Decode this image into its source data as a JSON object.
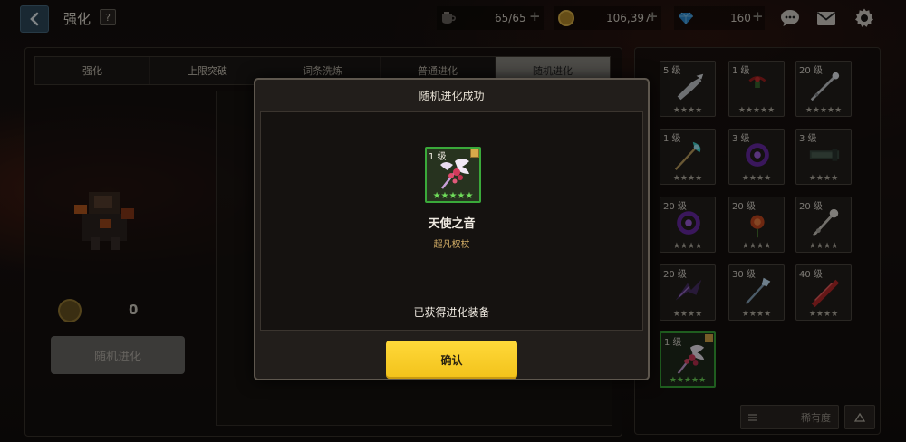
{
  "header": {
    "title": "强化",
    "help_label": "?",
    "stamina": "65/65",
    "gold": "106,397",
    "gems": "160",
    "plus": "+"
  },
  "tabs": [
    {
      "label": "强化",
      "active": false
    },
    {
      "label": "上限突破",
      "active": false
    },
    {
      "label": "词条洗炼",
      "active": false
    },
    {
      "label": "普通进化",
      "active": false
    },
    {
      "label": "随机进化",
      "active": true
    }
  ],
  "left": {
    "cost_amount": "0",
    "evolve_button": "随机进化"
  },
  "inventory": [
    {
      "level": "5 级",
      "stars": "★★★★",
      "icon": "gauntlet-icon"
    },
    {
      "level": "1 级",
      "stars": "★★★★★",
      "icon": "red-bow-icon"
    },
    {
      "level": "20 级",
      "stars": "★★★★★",
      "icon": "spiked-staff-icon"
    },
    {
      "level": "1 级",
      "stars": "★★★★",
      "icon": "cyan-staff-icon"
    },
    {
      "level": "3 级",
      "stars": "★★★★",
      "icon": "purple-ring-icon"
    },
    {
      "level": "3 级",
      "stars": "★★★★",
      "icon": "dark-cannon-icon"
    },
    {
      "level": "20 级",
      "stars": "★★★★",
      "icon": "purple-ring-icon"
    },
    {
      "level": "20 级",
      "stars": "★★★★",
      "icon": "flame-rose-icon"
    },
    {
      "level": "20 级",
      "stars": "★★★★",
      "icon": "bone-staff-icon"
    },
    {
      "level": "20 级",
      "stars": "★★★★",
      "icon": "purple-claw-icon"
    },
    {
      "level": "30 级",
      "stars": "★★★★",
      "icon": "frost-staff-icon"
    },
    {
      "level": "40 级",
      "stars": "★★★★",
      "icon": "red-blade-icon"
    },
    {
      "level": "1 级",
      "stars": "★★★★★",
      "icon": "angel-staff-icon",
      "selected": true
    }
  ],
  "sort": {
    "label": "稀有度"
  },
  "modal": {
    "title": "随机进化成功",
    "reward_level": "1 级",
    "reward_stars": "★★★★★",
    "item_name": "天使之音",
    "item_type": "超凡权杖",
    "obtained_text": "已获得进化装备",
    "confirm_label": "确认"
  },
  "colors": {
    "accent_yellow": "#f2c21a",
    "rarity_green": "#3aa93a",
    "gold_text": "#d6b068"
  }
}
